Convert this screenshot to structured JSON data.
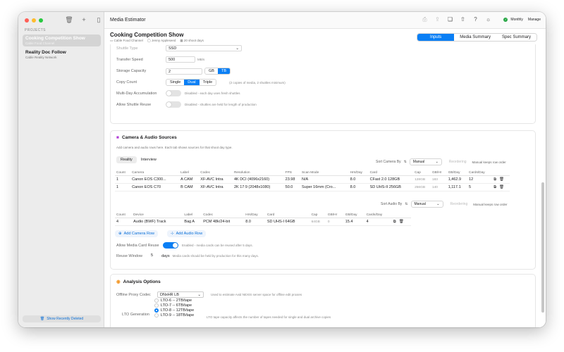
{
  "app": {
    "title": "Media Estimator"
  },
  "sidebar": {
    "section_label": "PROJECTS",
    "projects": [
      {
        "name": "Cooking Competition Show",
        "network": "Cable Food Channel"
      },
      {
        "name": "Reality Doc Follow",
        "network": "Cable Reality Network"
      }
    ],
    "footer_label": "Show Recently Deleted"
  },
  "toolbar": {
    "mode_label": "Monthly",
    "manage_label": "Manage"
  },
  "project": {
    "title": "Cooking Competition Show",
    "network": "Cable Food Channel",
    "producer": "Jenny Appleseed",
    "shoot_days": "20 shoot days"
  },
  "view_tabs": [
    "Inputs",
    "Media Summary",
    "Spec Summary"
  ],
  "shuttle": {
    "shuttle_type_label": "Shuttle Type",
    "shuttle_type_value": "SSD",
    "transfer_speed_label": "Transfer Speed",
    "transfer_speed_value": "500",
    "transfer_speed_unit": "MB/s",
    "storage_capacity_label": "Storage Capacity",
    "storage_capacity_value": "2",
    "capacity_units": [
      "GB",
      "TB"
    ],
    "copy_count_label": "Copy Count",
    "copy_options": [
      "Single",
      "Dual",
      "Triple"
    ],
    "copy_note": "(2 copies of media, 2 shuttles minimum)",
    "multi_day_label": "Multi-Day Accumulation",
    "multi_day_note": "Disabled - each day uses fresh shuttles",
    "allow_reuse_label": "Allow Shuttle Reuse",
    "allow_reuse_note": "Disabled - shuttles are held for length of production"
  },
  "sources": {
    "title": "Camera & Audio Sources",
    "description": "Add camera and audio rows here. Each tab shows sources for that shoot day type.",
    "tabs": [
      "Reality",
      "Interview"
    ],
    "sort_camera_label": "Sort Camera By",
    "sort_audio_label": "Sort Audio By",
    "sort_value": "Manual",
    "reorder_label": "Reordering",
    "keep_order_note": "Manual keeps row order",
    "camera_headers": [
      "Count",
      "Camera",
      "Label",
      "Codec",
      "Resolution",
      "FPS",
      "Scan Mode",
      "Hrs/Day",
      "Card",
      "Cap",
      "GB/Hr",
      "GB/Day",
      "Cards/Day"
    ],
    "camera_rows": [
      [
        "1",
        "Canon EOS C300...",
        "A CAM",
        "XF-AVC Intra",
        "4K DCI (4096x2160)",
        "23.98",
        "N/A",
        "8.0",
        "CFast 2.0 128GB",
        "128GB",
        "183",
        "1,462.9",
        "12"
      ],
      [
        "1",
        "Canon EOS C70",
        "B CAM",
        "XF-AVC Intra",
        "2K 17:9 (2048x1080)",
        "50.0",
        "Super 16mm (Cro...",
        "8.0",
        "SD UHS-II 256GB",
        "256GB",
        "140",
        "1,117.1",
        "5"
      ]
    ],
    "audio_headers": [
      "Count",
      "Device",
      "Label",
      "Codec",
      "Hrs/Day",
      "Card",
      "Cap",
      "GB/Hr",
      "GB/Day",
      "Cards/Day"
    ],
    "audio_rows": [
      [
        "4",
        "Audio (BWF) Track",
        "Bag A",
        "PCM 48k/24-bit",
        "8.0",
        "SD UHS-I 64GB",
        "64GB",
        "0",
        "15.4",
        "4"
      ]
    ],
    "add_camera_label": "Add Camera Row",
    "add_audio_label": "Add Audio Row",
    "media_reuse_label": "Allow Media Card Reuse",
    "media_reuse_note": "Enabled - media cards can be reused after 5 days.",
    "reuse_window_label": "Reuse Window",
    "reuse_window_value": "5",
    "reuse_window_unit": "days",
    "reuse_window_note": "Media cards should be held by production for this many days."
  },
  "analysis": {
    "title": "Analysis Options",
    "proxy_label": "Offline Proxy Codec",
    "proxy_value": "DNxHR LB",
    "proxy_note": "Used to estimate Avid NEXIS server space for offline edit proxies",
    "lto_label": "LTO Generation",
    "lto_options": [
      "LTO-6 -- 2TB/tape",
      "LTO-7 -- 6TB/tape",
      "LTO-8 -- 12TB/tape",
      "LTO-9 -- 18TB/tape"
    ],
    "lto_selected": 2,
    "lto_note": "LTO tape capacity affects the number of tapes needed for single and dual archive copies"
  },
  "colors": {
    "accent": "#0a7ff5",
    "camera_icon": "#b03bd6",
    "analysis_icon": "#f39a2c"
  },
  "icons": [
    "trash-icon",
    "plus-icon",
    "sidebar-icon",
    "printer-icon",
    "share-icon",
    "book-icon",
    "upload-icon",
    "help-icon",
    "gear-icon",
    "check-icon",
    "camera-icon",
    "chart-icon",
    "sort-icon",
    "trash-icon",
    "copy-icon",
    "plus-circle-icon",
    "mic-icon",
    "chevron-down-icon"
  ]
}
